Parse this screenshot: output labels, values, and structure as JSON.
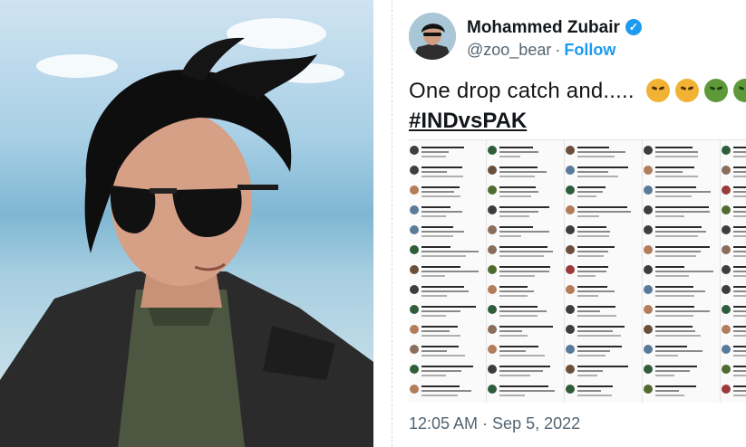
{
  "tweet": {
    "author_name": "Mohammed Zubair",
    "handle": "@zoo_bear",
    "separator": "·",
    "follow_label": "Follow",
    "text": "One drop catch and.....",
    "emojis": [
      "nauseated-face",
      "nauseated-face",
      "nauseated-face",
      "nauseated-face"
    ],
    "hashtag": "#INDvsPAK",
    "timestamp": "12:05 AM · Sep 5, 2022"
  },
  "colors": {
    "link": "#1d9bf0",
    "verified": "#1d9bf0",
    "text": "#14171a",
    "secondary": "#536471"
  }
}
